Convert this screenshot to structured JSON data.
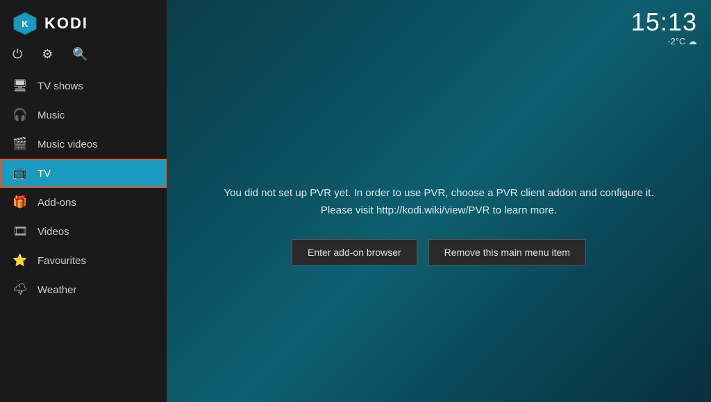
{
  "app": {
    "name": "KODI"
  },
  "clock": {
    "time": "15:13",
    "weather": "-2°C ☁"
  },
  "toolbar": {
    "power_icon": "⏻",
    "settings_icon": "⚙",
    "search_icon": "🔍"
  },
  "sidebar": {
    "items": [
      {
        "id": "tv-shows",
        "label": "TV shows",
        "icon": "🖥"
      },
      {
        "id": "music",
        "label": "Music",
        "icon": "🎧"
      },
      {
        "id": "music-videos",
        "label": "Music videos",
        "icon": "🎬"
      },
      {
        "id": "tv",
        "label": "TV",
        "icon": "📺",
        "active": true
      },
      {
        "id": "add-ons",
        "label": "Add-ons",
        "icon": "🎁"
      },
      {
        "id": "videos",
        "label": "Videos",
        "icon": "🎞"
      },
      {
        "id": "favourites",
        "label": "Favourites",
        "icon": "⭐"
      },
      {
        "id": "weather",
        "label": "Weather",
        "icon": "🌩"
      }
    ]
  },
  "main": {
    "pvr_message_line1": "You did not set up PVR yet. In order to use PVR, choose a PVR client addon and configure it.",
    "pvr_message_line2": "Please visit http://kodi.wiki/view/PVR to learn more.",
    "btn_addon_browser": "Enter add-on browser",
    "btn_remove_menu_item": "Remove this main menu item"
  }
}
